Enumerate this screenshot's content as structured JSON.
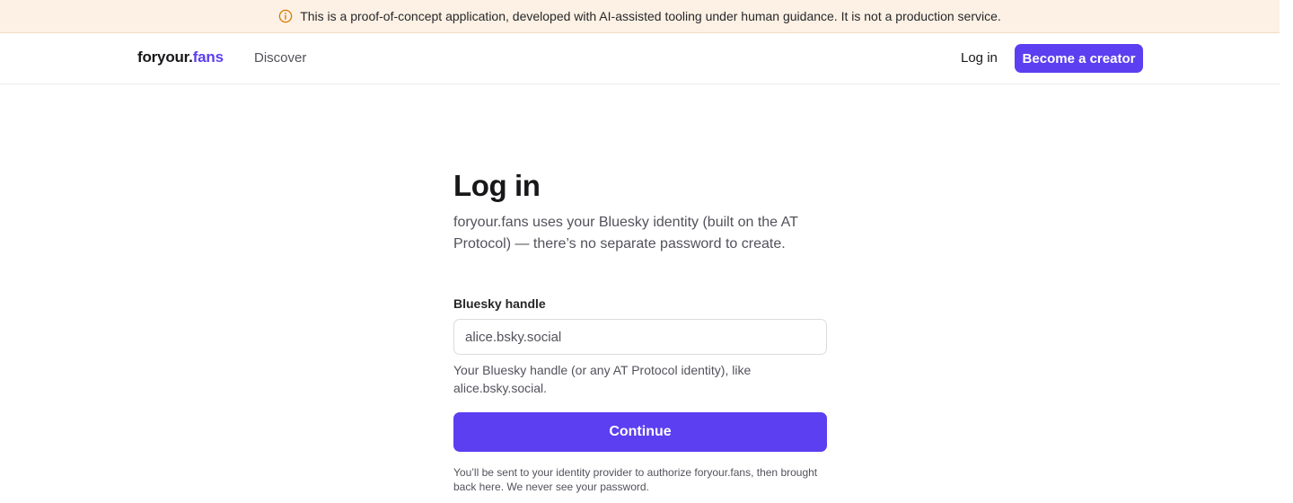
{
  "banner": {
    "icon": "info-circle-icon",
    "text": "This is a proof-of-concept application, developed with AI-assisted tooling under human guidance. It is not a production service."
  },
  "header": {
    "logo_main": "foryour.",
    "logo_accent": "fans",
    "nav_discover": "Discover",
    "login_link": "Log in",
    "creator_button": "Become a creator"
  },
  "main": {
    "title": "Log in",
    "intro": "foryour.fans uses your Bluesky identity (built on the AT Protocol) — there’s no separate password to create.",
    "field_label": "Bluesky handle",
    "input_value": "",
    "input_placeholder": "alice.bsky.social",
    "hint": "Your Bluesky handle (or any AT Protocol identity), like alice.bsky.social.",
    "continue_button": "Continue",
    "footnote": "You’ll be sent to your identity provider to authorize foryour.fans, then brought back here. We never see your password."
  },
  "colors": {
    "accent": "#5b3ff0",
    "banner_bg": "#fcf1e4",
    "banner_icon": "#d97706"
  }
}
